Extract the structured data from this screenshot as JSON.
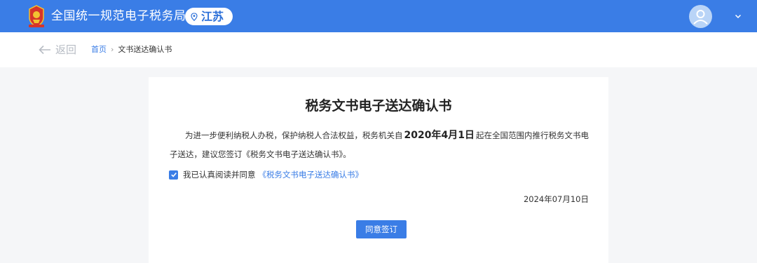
{
  "header": {
    "site_title": "全国统一规范电子税务局",
    "region": "江苏",
    "colors": {
      "bar": "#3a7de6",
      "avatar_bg": "#b9d4f7"
    }
  },
  "nav": {
    "back_label": "返回",
    "breadcrumb": {
      "home": "首页",
      "separator": "›",
      "current": "文书送达确认书"
    }
  },
  "document": {
    "title": "税务文书电子送达确认书",
    "para_before": "为进一步便利纳税人办税，保护纳税人合法权益，税务机关自",
    "para_date": "2020年4月1日",
    "para_after": "起在全国范围内推行税务文书电子送达，建议您签订《税务文书电子送达确认书》。",
    "agree_text": "我已认真阅读并同意",
    "agree_link": "《税务文书电子送达确认书》",
    "agree_checked": true,
    "date": "2024年07月10日",
    "sign_button": "同意签订"
  }
}
